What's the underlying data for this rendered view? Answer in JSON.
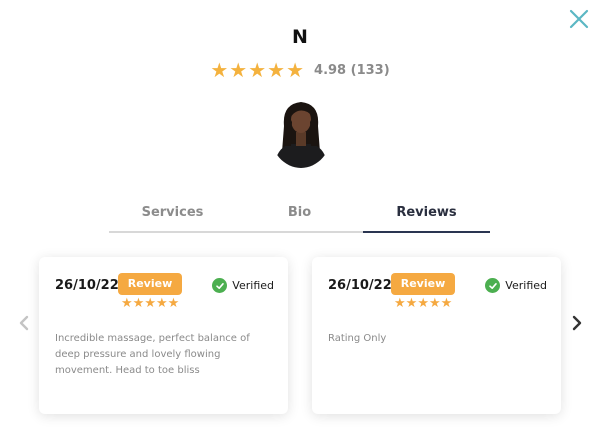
{
  "profile": {
    "name": "N",
    "rating_text": "4.98 (133)",
    "stars": 5
  },
  "tabs": [
    {
      "label": "Services",
      "active": false
    },
    {
      "label": "Bio",
      "active": false
    },
    {
      "label": "Reviews",
      "active": true
    }
  ],
  "reviews": [
    {
      "date": "26/10/22",
      "badge": "Review",
      "stars": 5,
      "verified_label": "Verified",
      "text": "Incredible massage, perfect balance of deep pressure and lovely flowing movement. Head to toe bliss"
    },
    {
      "date": "26/10/22",
      "badge": "Review",
      "stars": 5,
      "verified_label": "Verified",
      "text": "Rating Only"
    }
  ],
  "icons": {
    "close": "close-icon",
    "star": "star-icon",
    "check": "check-circle-icon",
    "prev": "chevron-left-icon",
    "next": "chevron-right-icon"
  },
  "colors": {
    "star": "#f4b23e",
    "badge": "#f5a941",
    "verified": "#4caf50",
    "close": "#5bb7c4",
    "active_tab_underline": "#2a3551"
  }
}
